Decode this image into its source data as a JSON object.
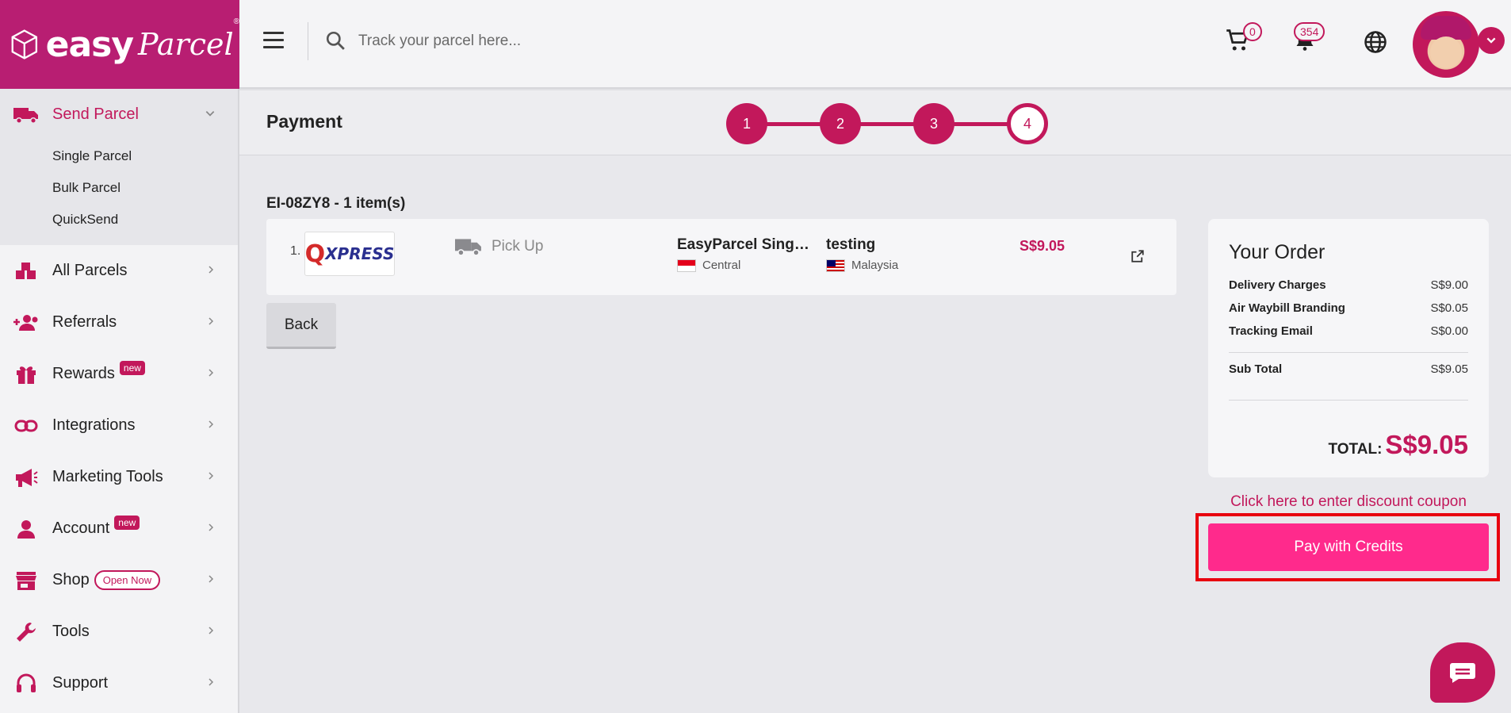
{
  "brand": {
    "logo_main": "easy",
    "logo_script": "Parcel",
    "reg": "®",
    "color": "#b81e72"
  },
  "header": {
    "search_placeholder": "Track your parcel here...",
    "cart_count": "0",
    "notification_count": "354"
  },
  "sidebar": {
    "send_parcel": {
      "label": "Send Parcel",
      "sub": [
        "Single Parcel",
        "Bulk Parcel",
        "QuickSend"
      ]
    },
    "items": [
      {
        "label": "All Parcels",
        "icon": "boxes-icon"
      },
      {
        "label": "Referrals",
        "icon": "people-add-icon"
      },
      {
        "label": "Rewards",
        "icon": "gift-icon",
        "badge": "new"
      },
      {
        "label": "Integrations",
        "icon": "link-icon"
      },
      {
        "label": "Marketing Tools",
        "icon": "megaphone-icon"
      },
      {
        "label": "Account",
        "icon": "person-icon",
        "badge": "new"
      },
      {
        "label": "Shop",
        "icon": "store-icon",
        "pill": "Open Now"
      },
      {
        "label": "Tools",
        "icon": "wrench-icon"
      },
      {
        "label": "Support",
        "icon": "headset-icon"
      }
    ]
  },
  "page": {
    "title": "Payment",
    "steps": [
      "1",
      "2",
      "3",
      "4"
    ],
    "current_step": 4,
    "order_ref": "EI-08ZY8 - 1 item(s)",
    "parcel": {
      "index": "1.",
      "courier": {
        "q": "Q",
        "x": "XPRESS"
      },
      "pickup_label": "Pick Up",
      "sender_name": "EasyParcel Singapore",
      "sender_region": "Central",
      "receiver_name": "testing",
      "receiver_country": "Malaysia",
      "price": "S$9.05"
    },
    "back_label": "Back"
  },
  "order": {
    "title": "Your Order",
    "lines": [
      {
        "label": "Delivery Charges",
        "value": "S$9.00"
      },
      {
        "label": "Air Waybill Branding",
        "value": "S$0.05"
      },
      {
        "label": "Tracking Email",
        "value": "S$0.00"
      }
    ],
    "subtotal_label": "Sub Total",
    "subtotal_value": "S$9.05",
    "total_label": "TOTAL:",
    "total_value": "S$9.05",
    "coupon_link": "Click here to enter discount coupon",
    "pay_label": "Pay with Credits"
  },
  "colors": {
    "accent": "#c2185b",
    "pay_button": "#ff2a8c",
    "highlight_frame": "#e8000f"
  }
}
